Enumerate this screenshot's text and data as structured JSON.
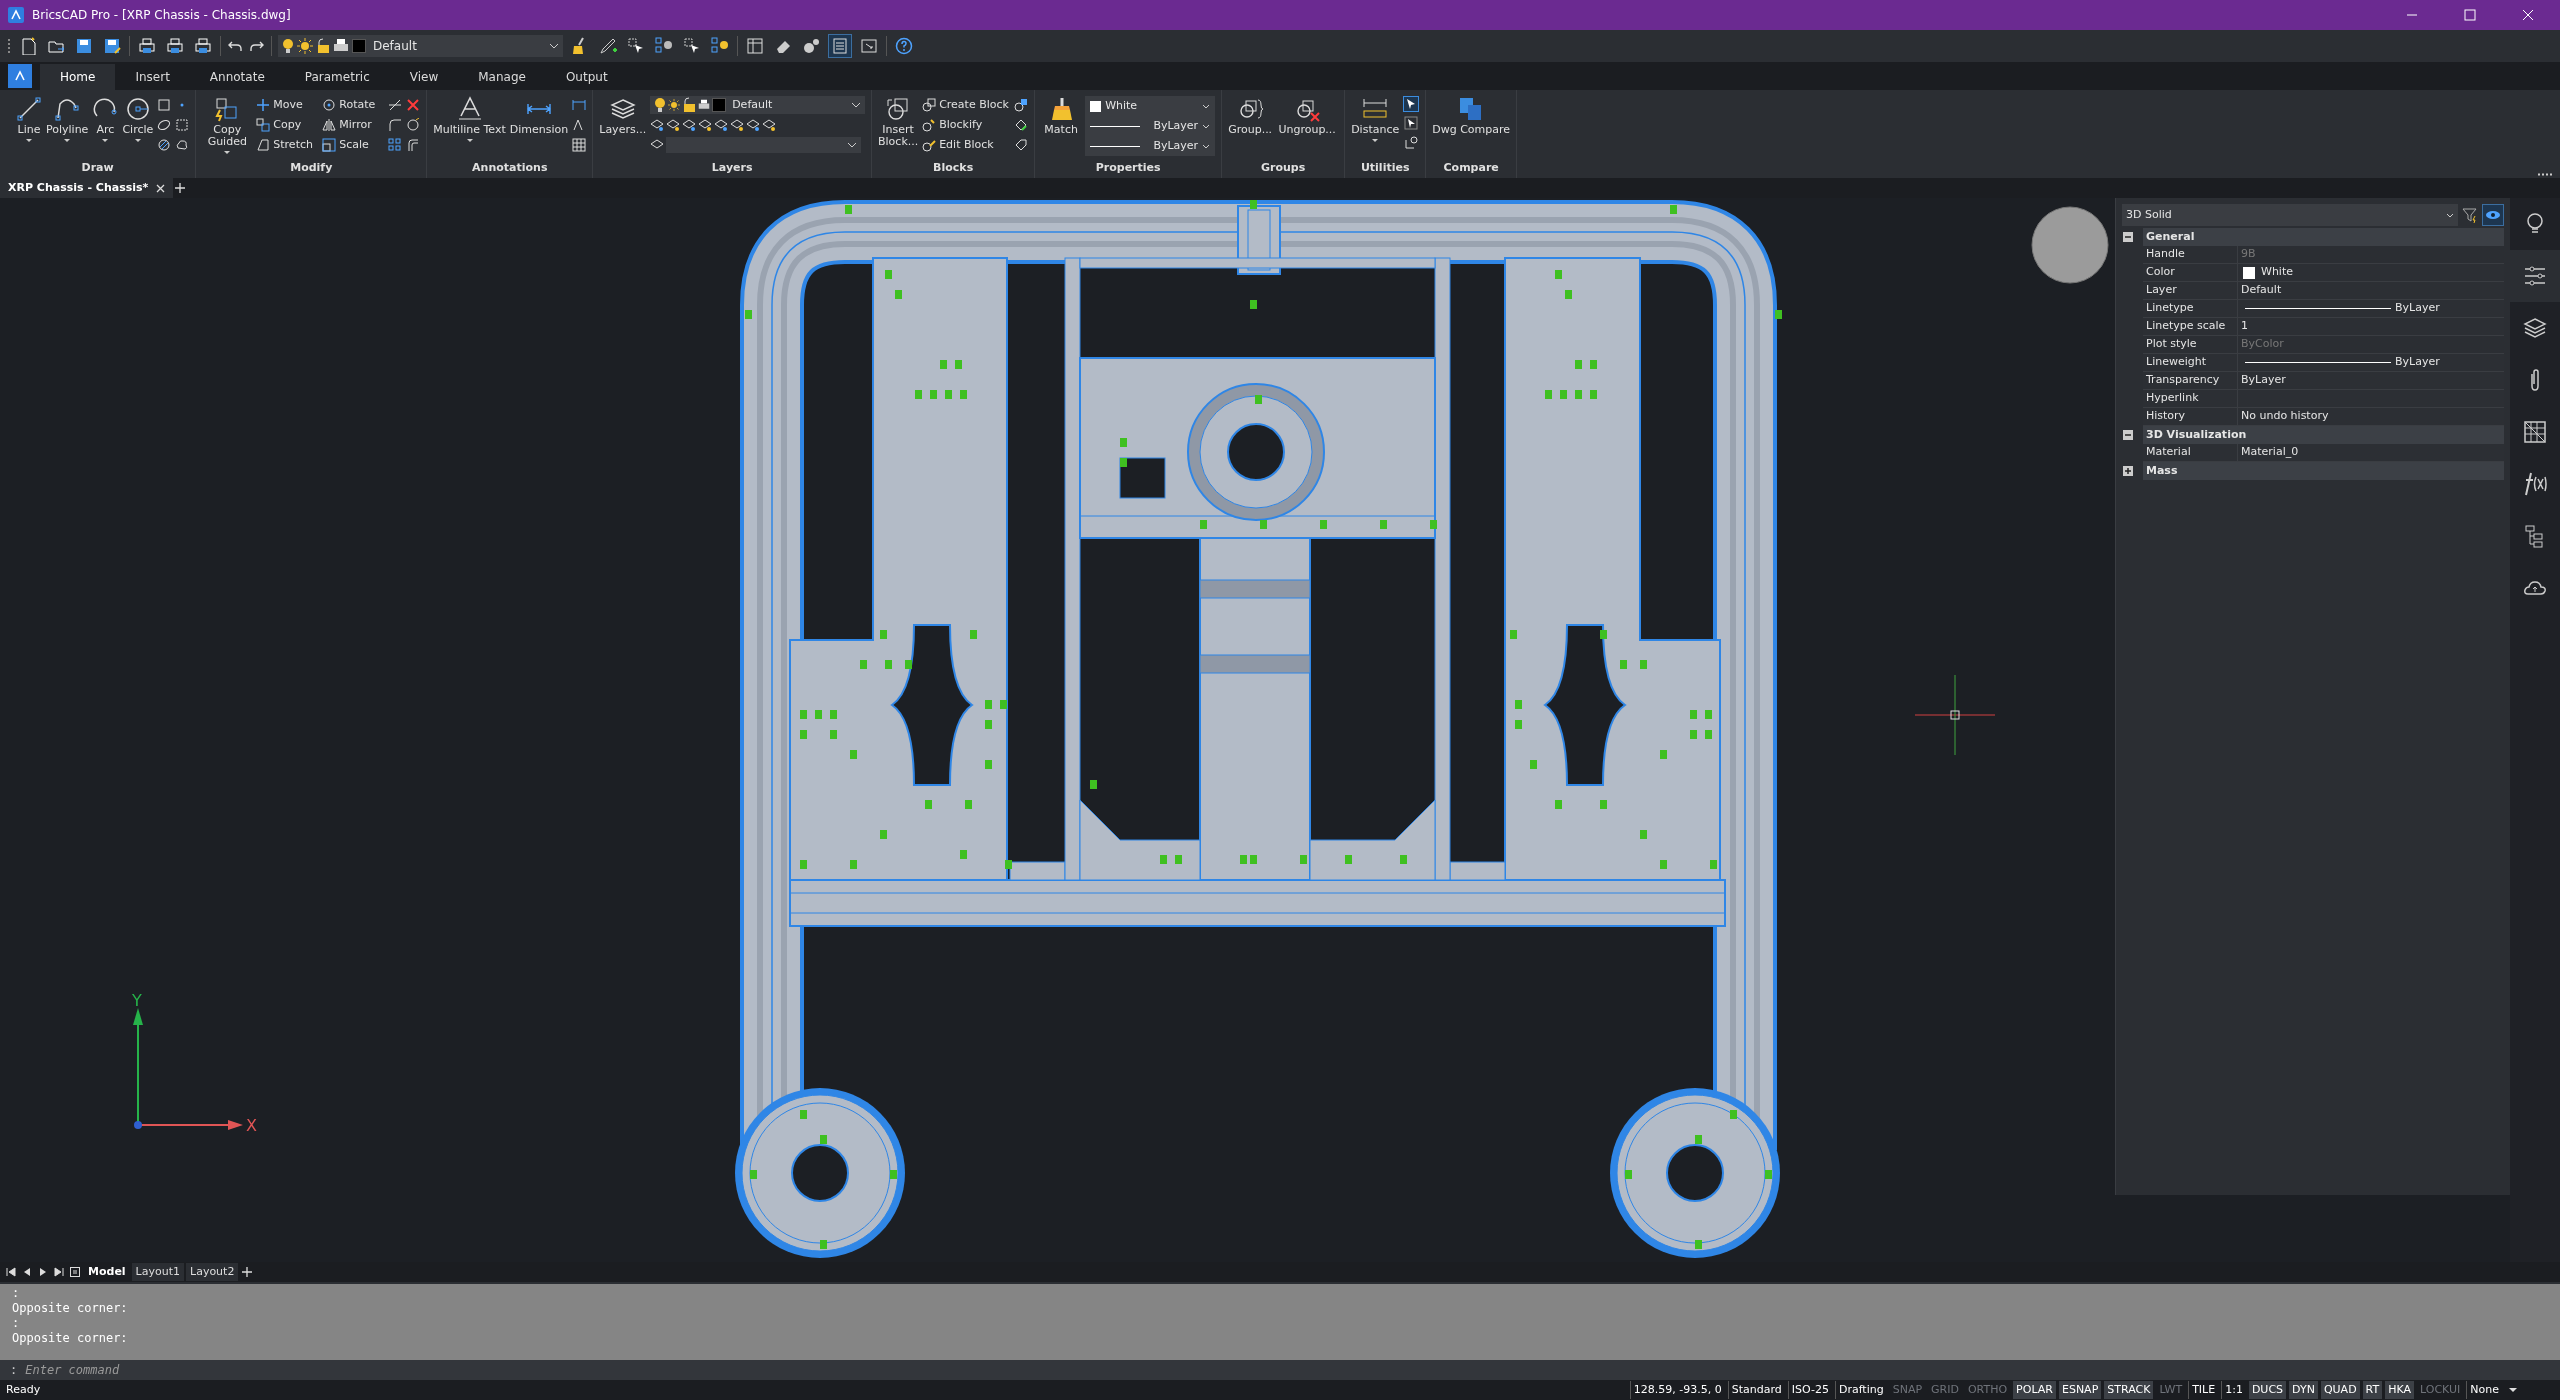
{
  "window": {
    "title": "BricsCAD Pro - [XRP Chassis - Chassis.dwg]"
  },
  "quick_access": {
    "layer": "Default"
  },
  "ribbon_tabs": [
    {
      "label": "Home",
      "selected": true
    },
    {
      "label": "Insert",
      "selected": false
    },
    {
      "label": "Annotate",
      "selected": false
    },
    {
      "label": "Parametric",
      "selected": false
    },
    {
      "label": "View",
      "selected": false
    },
    {
      "label": "Manage",
      "selected": false
    },
    {
      "label": "Output",
      "selected": false
    }
  ],
  "ribbon": {
    "draw": {
      "title": "Draw",
      "large": [
        "Line",
        "Polyline",
        "Arc",
        "Circle"
      ]
    },
    "modify": {
      "title": "Modify",
      "large": [
        "Copy Guided"
      ],
      "small": [
        "Move",
        "Copy",
        "Stretch",
        "Rotate",
        "Mirror",
        "Scale"
      ]
    },
    "annotations": {
      "title": "Annotations",
      "large": [
        "Multiline Text",
        "Dimension"
      ]
    },
    "layers": {
      "title": "Layers",
      "large": [
        "Layers..."
      ],
      "layer": "Default"
    },
    "blocks": {
      "title": "Blocks",
      "large": [
        "Insert Block..."
      ],
      "small": [
        "Create Block",
        "Blockify",
        "Edit Block"
      ]
    },
    "properties": {
      "title": "Properties",
      "large": [
        "Match"
      ],
      "color_name": "White",
      "linetype": "ByLayer",
      "lineweight": "ByLayer"
    },
    "groups": {
      "title": "Groups",
      "large": [
        "Group...",
        "Ungroup..."
      ]
    },
    "utilities": {
      "title": "Utilities",
      "large": [
        "Distance"
      ]
    },
    "compare": {
      "title": "Compare",
      "large": [
        "Dwg Compare"
      ]
    }
  },
  "document_tabs": [
    {
      "label": "XRP Chassis - Chassis*",
      "selected": true
    }
  ],
  "viewport": {
    "axis_labels": [
      "X",
      "Y"
    ]
  },
  "properties_panel": {
    "selection": "3D Solid",
    "sections": [
      {
        "title": "General",
        "expanded": true,
        "rows": [
          {
            "label": "Handle",
            "value": "9B",
            "kind": "text",
            "disabled": true
          },
          {
            "label": "Color",
            "value": "White",
            "kind": "color",
            "disabled": false
          },
          {
            "label": "Layer",
            "value": "Default",
            "kind": "text",
            "disabled": false
          },
          {
            "label": "Linetype",
            "value": "ByLayer",
            "kind": "line",
            "disabled": false
          },
          {
            "label": "Linetype scale",
            "value": "1",
            "kind": "text",
            "disabled": false
          },
          {
            "label": "Plot style",
            "value": "ByColor",
            "kind": "text",
            "disabled": true
          },
          {
            "label": "Lineweight",
            "value": "ByLayer",
            "kind": "line",
            "disabled": false
          },
          {
            "label": "Transparency",
            "value": "ByLayer",
            "kind": "text",
            "disabled": false
          },
          {
            "label": "Hyperlink",
            "kind": "text",
            "disabled": false
          },
          {
            "label": "History",
            "value": "No undo history",
            "kind": "text",
            "disabled": false
          }
        ]
      },
      {
        "title": "3D Visualization",
        "expanded": true,
        "rows": [
          {
            "label": "Material",
            "value": "Material_0",
            "kind": "text",
            "disabled": false
          }
        ]
      },
      {
        "title": "Mass",
        "expanded": false
      }
    ]
  },
  "layout_tabs": [
    {
      "label": "Model",
      "selected": true
    },
    {
      "label": "Layout1",
      "selected": false
    },
    {
      "label": "Layout2",
      "selected": false
    }
  ],
  "command_line": {
    "history": [
      ":",
      "Opposite corner:",
      ":",
      "Opposite corner:"
    ],
    "prompt": ":",
    "placeholder": "Enter command"
  },
  "status_bar": {
    "message": "Ready",
    "items": [
      {
        "label": "128.59, -93.5, 0",
        "kind": "text"
      },
      {
        "label": "Standard",
        "kind": "text"
      },
      {
        "label": "ISO-25",
        "kind": "text"
      },
      {
        "label": "Drafting",
        "kind": "text"
      },
      {
        "label": "SNAP",
        "kind": "toggle",
        "on": false
      },
      {
        "label": "GRID",
        "kind": "toggle",
        "on": false
      },
      {
        "label": "ORTHO",
        "kind": "toggle",
        "on": false
      },
      {
        "label": "POLAR",
        "kind": "toggle",
        "on": true
      },
      {
        "label": "ESNAP",
        "kind": "toggle",
        "on": true
      },
      {
        "label": "STRACK",
        "kind": "toggle",
        "on": true
      },
      {
        "label": "LWT",
        "kind": "toggle",
        "on": false
      },
      {
        "label": "TILE",
        "kind": "text"
      },
      {
        "label": "1:1",
        "kind": "text"
      },
      {
        "label": "DUCS",
        "kind": "toggle",
        "on": true
      },
      {
        "label": "DYN",
        "kind": "toggle",
        "on": true
      },
      {
        "label": "QUAD",
        "kind": "toggle",
        "on": true
      },
      {
        "label": "RT",
        "kind": "toggle",
        "on": true
      },
      {
        "label": "HKA",
        "kind": "toggle",
        "on": true
      },
      {
        "label": "LOCKUI",
        "kind": "toggle",
        "on": false
      },
      {
        "label": "None",
        "kind": "text"
      }
    ]
  }
}
